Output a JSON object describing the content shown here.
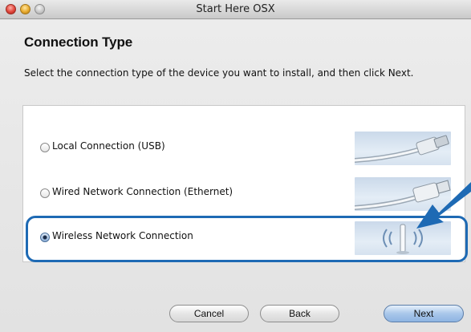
{
  "window": {
    "title": "Start Here OSX"
  },
  "page": {
    "title": "Connection Type",
    "instruction": "Select the connection type of the device you want to install, and then click Next."
  },
  "options": [
    {
      "label": "Local Connection (USB)",
      "selected": false,
      "icon": "usb-cable-icon"
    },
    {
      "label": "Wired Network Connection (Ethernet)",
      "selected": false,
      "icon": "ethernet-cable-icon"
    },
    {
      "label": "Wireless Network Connection",
      "selected": true,
      "icon": "wireless-antenna-icon"
    }
  ],
  "buttons": {
    "cancel": "Cancel",
    "back": "Back",
    "next": "Next"
  },
  "colors": {
    "highlight": "#1e6ab4",
    "default_button": "#8eb4e2"
  }
}
